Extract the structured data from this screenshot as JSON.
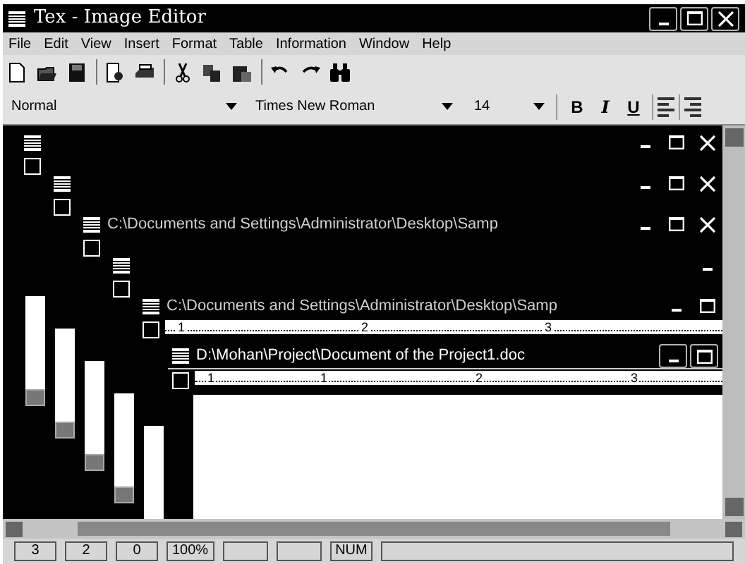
{
  "window": {
    "title": "Tex - Image Editor"
  },
  "menu": [
    "File",
    "Edit",
    "View",
    "Insert",
    "Format",
    "Table",
    "Information",
    "Window",
    "Help"
  ],
  "toolbar": [
    {
      "kind": "new"
    },
    {
      "kind": "open"
    },
    {
      "kind": "save"
    },
    {
      "kind": "sep"
    },
    {
      "kind": "preview"
    },
    {
      "kind": "print"
    },
    {
      "kind": "sep"
    },
    {
      "kind": "cut"
    },
    {
      "kind": "copy"
    },
    {
      "kind": "paste"
    },
    {
      "kind": "sep"
    },
    {
      "kind": "undo"
    },
    {
      "kind": "redo"
    },
    {
      "kind": "find"
    }
  ],
  "format_bar": {
    "style": "Normal",
    "font": "Times New Roman",
    "size": "14",
    "buttons": [
      {
        "kind": "bold",
        "label": "B"
      },
      {
        "kind": "italic",
        "label": "I"
      },
      {
        "kind": "underline",
        "label": "U"
      },
      {
        "kind": "align-left"
      },
      {
        "kind": "align-right"
      }
    ]
  },
  "documents": [
    {
      "maximize_button": true,
      "close_button": true,
      "active": false
    },
    {
      "maximize_button": true,
      "close_button": true,
      "active": false
    },
    {
      "title": "C:\\Documents and Settings\\Administrator\\Desktop\\Samp",
      "maximize_button": true,
      "close_button": true,
      "active": false
    },
    {
      "maximize_button": false,
      "close_button": false,
      "active": false
    },
    {
      "title": "C:\\Documents and Settings\\Administrator\\Desktop\\Samp",
      "maximize_button": true,
      "close_button": false,
      "ruler": [
        "1",
        "2",
        "3"
      ],
      "active": false
    },
    {
      "title": "D:\\Mohan\\Project\\Document of the Project1.doc",
      "maximize_button": true,
      "close_button": false,
      "ruler": [
        "1",
        "1",
        "2",
        "3"
      ],
      "active": true
    }
  ],
  "status_bar": [
    {
      "text": "3"
    },
    {
      "text": "2"
    },
    {
      "text": "0"
    },
    {
      "text": "100%"
    },
    {
      "kind": "blank"
    },
    {
      "kind": "blank"
    },
    {
      "text": "NUM"
    },
    {
      "kind": "blank"
    }
  ]
}
